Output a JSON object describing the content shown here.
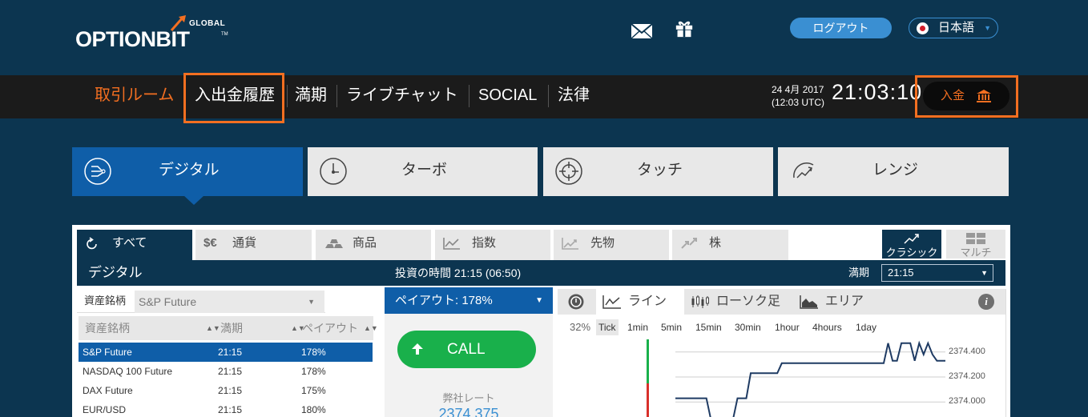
{
  "header": {
    "logo_text": "OPTIONBIT",
    "logo_global": "GLOBAL",
    "logo_tm": "TM",
    "logout_label": "ログアウト",
    "language": "日本語"
  },
  "nav": {
    "items": [
      "取引ルーム",
      "入出金履歴",
      "満期",
      "ライブチャット",
      "SOCIAL",
      "法律"
    ],
    "date": "24 4月 2017",
    "utc_time": "(12:03 UTC)",
    "clock": "21:03:10",
    "deposit_label": "入金"
  },
  "mode_tabs": [
    "デジタル",
    "ターボ",
    "タッチ",
    "レンジ"
  ],
  "asset_tabs": [
    "すべて",
    "通貨",
    "商品",
    "指数",
    "先物",
    "株"
  ],
  "currency_icon": "$€",
  "views": {
    "classic": "クラシック",
    "multi": "マルチ"
  },
  "subbar": {
    "title": "デジタル",
    "invest_time": "投資の時間 21:15 (06:50)",
    "expiry_label": "満期",
    "expiry_value": "21:15"
  },
  "asset_filter": {
    "label": "資産銘柄",
    "value": "S&P Future"
  },
  "list": {
    "headers": [
      "資産銘柄",
      "満期",
      "ペイアウト"
    ],
    "rows": [
      {
        "name": "S&P Future",
        "expiry": "21:15",
        "payout": "178%"
      },
      {
        "name": "NASDAQ 100 Future",
        "expiry": "21:15",
        "payout": "178%"
      },
      {
        "name": "DAX Future",
        "expiry": "21:15",
        "payout": "175%"
      },
      {
        "name": "EUR/USD",
        "expiry": "21:15",
        "payout": "180%"
      }
    ]
  },
  "trade": {
    "payout": "ペイアウト:  178%",
    "call_label": "CALL",
    "rate_label": "弊社レート",
    "rate_value": "2374.375"
  },
  "chart_tabs": [
    "ライン",
    "ローソク足",
    "エリア"
  ],
  "intervals": {
    "percent": "32%",
    "items": [
      "Tick",
      "1min",
      "5min",
      "15min",
      "30min",
      "1hour",
      "4hours",
      "1day"
    ]
  },
  "chart_data": {
    "type": "line",
    "y_ticks": [
      "2374.400",
      "2374.200",
      "2374.000"
    ],
    "y_tick_values": [
      2374.4,
      2374.2,
      2374.0
    ],
    "ylim": [
      2373.88,
      2374.52
    ],
    "series": [
      {
        "values": [
          2374.03,
          2374.03,
          2374.03,
          2374.03,
          2374.03,
          2374.03,
          2374.03,
          2374.03,
          2373.86,
          2373.86,
          2373.86,
          2373.86,
          2373.86,
          2373.86,
          2374.03,
          2374.03,
          2374.03,
          2374.23,
          2374.23,
          2374.23,
          2374.23,
          2374.23,
          2374.23,
          2374.23,
          2374.31,
          2374.31,
          2374.31,
          2374.31,
          2374.31,
          2374.31,
          2374.31,
          2374.31,
          2374.31,
          2374.31,
          2374.31,
          2374.31,
          2374.31,
          2374.31,
          2374.31,
          2374.31,
          2374.31,
          2374.31,
          2374.31,
          2374.31,
          2374.31,
          2374.31,
          2374.31,
          2374.31,
          2374.47,
          2374.33,
          2374.33,
          2374.47,
          2374.47,
          2374.47,
          2374.33,
          2374.47,
          2374.38,
          2374.47,
          2374.38,
          2374.33,
          2374.33,
          2374.33,
          2374.33
        ]
      }
    ]
  },
  "colors": {
    "background": "#0c3550",
    "accent_orange": "#f36f21",
    "tab_blue": "#0f5ea8",
    "call_green": "#19b04b",
    "logout_blue": "#3a8fd2"
  }
}
